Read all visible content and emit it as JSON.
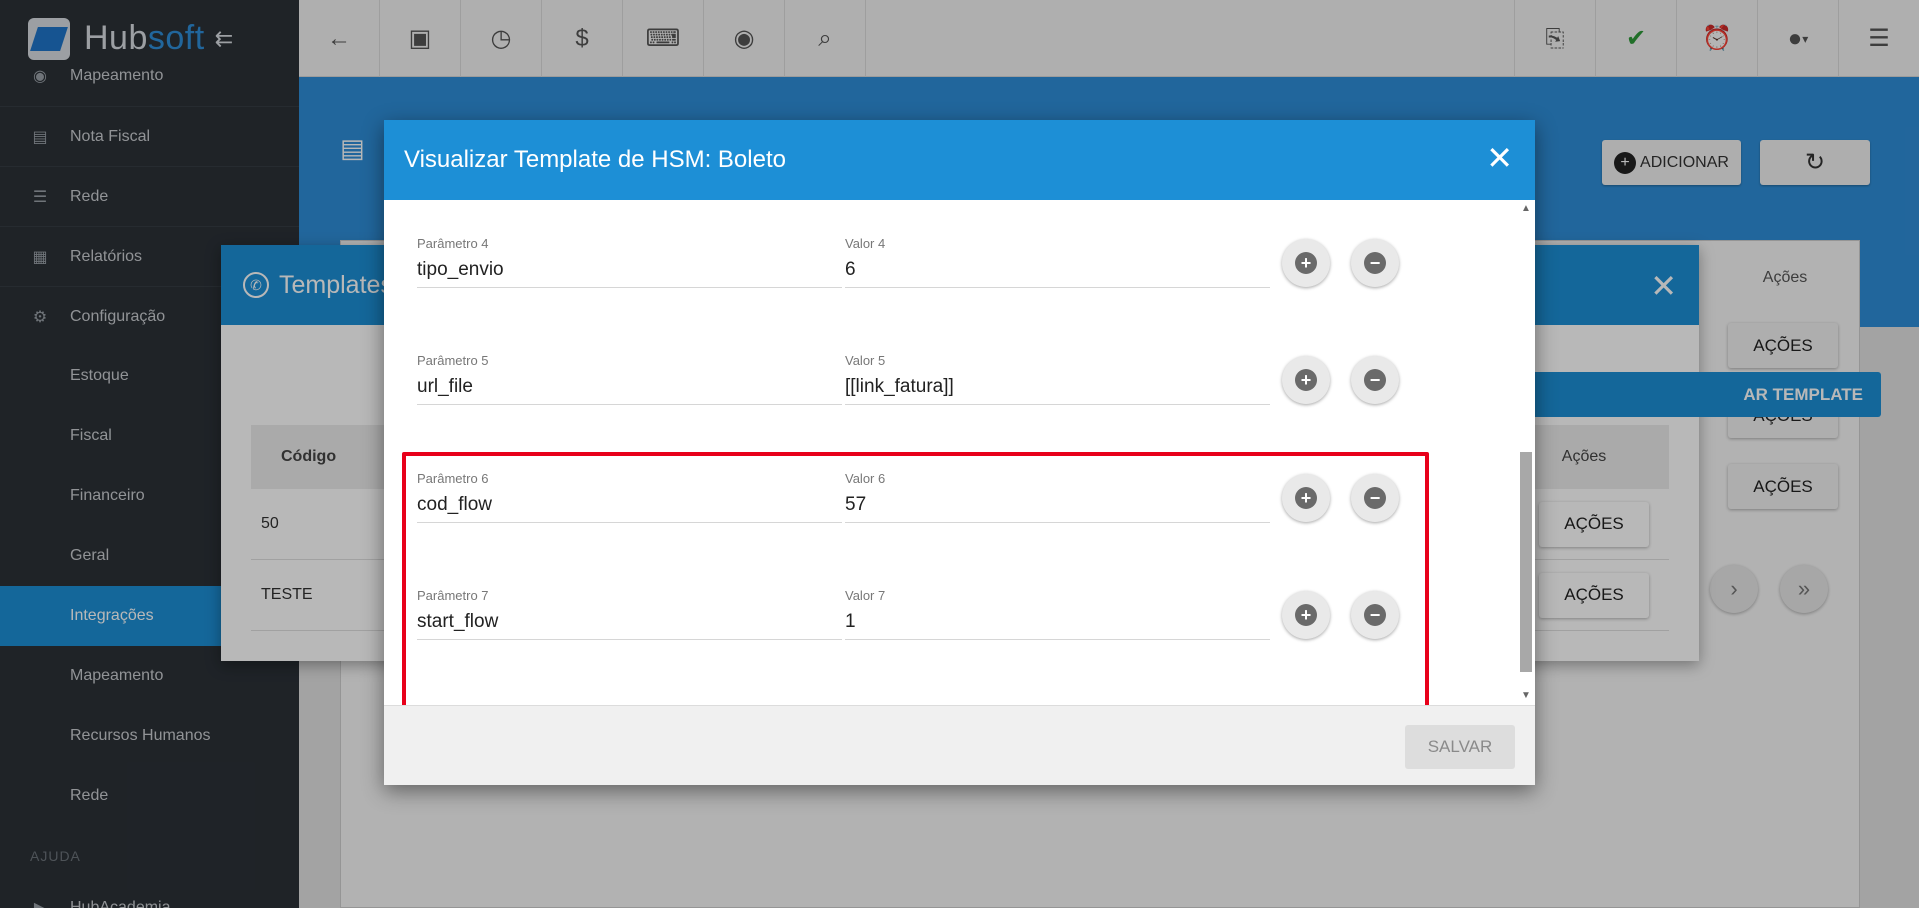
{
  "sidebar": {
    "logo_hub": "Hub",
    "logo_soft": "soft",
    "items": [
      {
        "label": "Mapeamento",
        "icon": "map-icon"
      },
      {
        "label": "Nota Fiscal",
        "icon": "receipt-icon"
      },
      {
        "label": "Rede",
        "icon": "network-icon"
      },
      {
        "label": "Relatórios",
        "icon": "report-icon"
      },
      {
        "label": "Configuração",
        "icon": "gear-icon"
      },
      {
        "label": "Estoque"
      },
      {
        "label": "Fiscal"
      },
      {
        "label": "Financeiro"
      },
      {
        "label": "Geral"
      },
      {
        "label": "Integrações"
      },
      {
        "label": "Mapeamento"
      },
      {
        "label": "Recursos Humanos"
      },
      {
        "label": "Rede"
      },
      {
        "label": "HubAcademia",
        "icon": "academy-icon"
      }
    ],
    "section_help": "AJUDA"
  },
  "page": {
    "add_label": "ADICIONAR",
    "acoes_header": "Ações",
    "acoes_label": "AÇÕES"
  },
  "templates_modal": {
    "title": "Templates",
    "add_button": "AR TEMPLATE",
    "col_code": "Código",
    "col_actions": "Ações",
    "rows": [
      {
        "code": "50",
        "action": "AÇÕES"
      },
      {
        "code": "TESTE",
        "action": "AÇÕES"
      }
    ]
  },
  "hsm_modal": {
    "title": "Visualizar Template de HSM: Boleto",
    "save_label": "SALVAR",
    "params": [
      {
        "param_label": "Parâmetro 4",
        "param_value": "tipo_envio",
        "value_label": "Valor 4",
        "value": "6"
      },
      {
        "param_label": "Parâmetro 5",
        "param_value": "url_file",
        "value_label": "Valor 5",
        "value": "[[link_fatura]]"
      },
      {
        "param_label": "Parâmetro 6",
        "param_value": "cod_flow",
        "value_label": "Valor 6",
        "value": "57"
      },
      {
        "param_label": "Parâmetro 7",
        "param_value": "start_flow",
        "value_label": "Valor 7",
        "value": "1"
      }
    ]
  },
  "colors": {
    "primary": "#1d8fd6",
    "sidebar": "#2b3137",
    "highlight": "#e8001a"
  }
}
